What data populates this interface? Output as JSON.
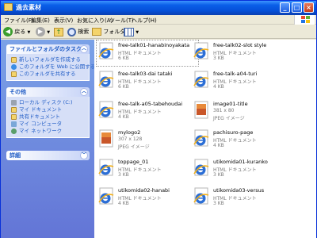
{
  "window": {
    "title": "過去素材"
  },
  "menu": [
    "ファイル(F)",
    "編集(E)",
    "表示(V)",
    "お気に入り(A)",
    "ツール(T)",
    "ヘルプ(H)"
  ],
  "toolbar": {
    "back": "戻る",
    "search": "検索",
    "folders": "フォルダ"
  },
  "panels": {
    "tasks": {
      "title": "ファイルとフォルダのタスク",
      "items": [
        "新しいフォルダを作成する",
        "このフォルダを Web に公開する",
        "このフォルダを共有する"
      ]
    },
    "places": {
      "title": "その他",
      "items": [
        "ローカル ディスク (C:)",
        "マイ ドキュメント",
        "共有ドキュメント",
        "マイ コンピュータ",
        "マイ ネットワーク"
      ]
    },
    "details": {
      "title": "詳細"
    }
  },
  "files": [
    {
      "name": "free-talk01-hanabinoyakata",
      "type": "HTML ドキュメント",
      "size": "6 KB",
      "icon": "ie-icon"
    },
    {
      "name": "free-talk02-slot style",
      "type": "HTML ドキュメント",
      "size": "3 KB",
      "icon": "ie-icon"
    },
    {
      "name": "free-talk03-dai tataki",
      "type": "HTML ドキュメント",
      "size": "6 KB",
      "icon": "ie-icon"
    },
    {
      "name": "free-talk-a04-turi",
      "type": "HTML ドキュメント",
      "size": "4 KB",
      "icon": "ie-icon"
    },
    {
      "name": "free-talk-a05-tabehoudai",
      "type": "HTML ドキュメント",
      "size": "4 KB",
      "icon": "ie-icon"
    },
    {
      "name": "image01-title",
      "type": "JPEG イメージ",
      "size": "3 KB",
      "sub": "381 x 80",
      "icon": "jpeg-icon"
    },
    {
      "name": "mylogo2",
      "type": "JPEG イメージ",
      "size": "",
      "sub": "307 x 128",
      "icon": "jpeg-icon"
    },
    {
      "name": "pachisuro-page",
      "type": "HTML ドキュメント",
      "size": "4 KB",
      "icon": "ie-icon"
    },
    {
      "name": "toppage_01",
      "type": "HTML ドキュメント",
      "size": "3 KB",
      "icon": "ie-icon"
    },
    {
      "name": "utikomida01-kuranko",
      "type": "HTML ドキュメント",
      "size": "3 KB",
      "icon": "ie-icon"
    },
    {
      "name": "utikomida02-hanabi",
      "type": "HTML ドキュメント",
      "size": "4 KB",
      "icon": "ie-icon"
    },
    {
      "name": "utikomida03-versus",
      "type": "HTML ドキュメント",
      "size": "3 KB",
      "icon": "ie-icon"
    }
  ],
  "colors": {
    "titlebar": "#0a5fe8",
    "taskpane": "#6375d6",
    "link": "#215dc6"
  }
}
